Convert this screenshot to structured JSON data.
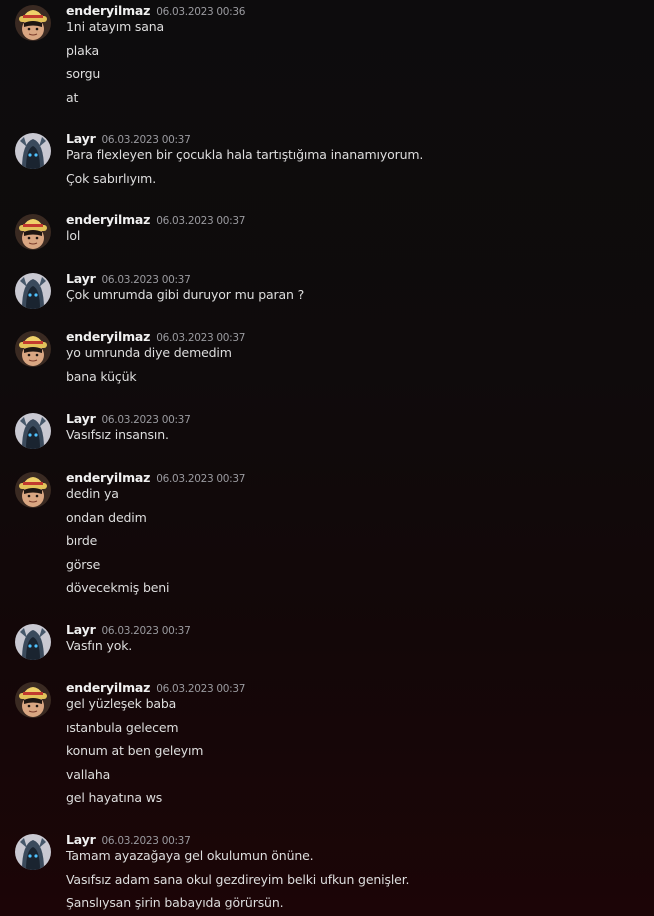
{
  "users": {
    "ender": {
      "name": "enderyilmaz",
      "avatar_icon": "straw-hat-avatar-icon"
    },
    "layr": {
      "name": "Layr",
      "avatar_icon": "hooded-figure-avatar-icon"
    }
  },
  "messages": [
    {
      "user": "enderyilmaz",
      "timestamp": "06.03.2023 00:36",
      "lines": [
        "1ni atayım sana",
        "plaka",
        "sorgu",
        "at"
      ]
    },
    {
      "user": "Layr",
      "timestamp": "06.03.2023 00:37",
      "lines": [
        "Para flexleyen bir çocukla hala tartıştığıma inanamıyorum.",
        "Çok sabırlıyım."
      ]
    },
    {
      "user": "enderyilmaz",
      "timestamp": "06.03.2023 00:37",
      "lines": [
        "lol"
      ]
    },
    {
      "user": "Layr",
      "timestamp": "06.03.2023 00:37",
      "lines": [
        "Çok umrumda gibi duruyor mu paran ?"
      ]
    },
    {
      "user": "enderyilmaz",
      "timestamp": "06.03.2023 00:37",
      "lines": [
        "yo umrunda diye demedim",
        "bana küçük"
      ]
    },
    {
      "user": "Layr",
      "timestamp": "06.03.2023 00:37",
      "lines": [
        "Vasıfsız insansın."
      ]
    },
    {
      "user": "enderyilmaz",
      "timestamp": "06.03.2023 00:37",
      "lines": [
        "dedin ya",
        "ondan dedim",
        "bırde",
        "görse",
        "dövecekmiş beni"
      ]
    },
    {
      "user": "Layr",
      "timestamp": "06.03.2023 00:37",
      "lines": [
        "Vasfın yok."
      ]
    },
    {
      "user": "enderyilmaz",
      "timestamp": "06.03.2023 00:37",
      "lines": [
        "gel yüzleşek baba",
        "ıstanbula gelecem",
        "konum at ben geleyım",
        "vallaha",
        "gel hayatına ws"
      ]
    },
    {
      "user": "Layr",
      "timestamp": "06.03.2023 00:37",
      "lines": [
        "Tamam ayazağaya gel okulumun önüne.",
        "Vasıfsız adam sana okul gezdireyim belki ufkun genişler.",
        "Şanslıysan şirin babayıda görürsün."
      ]
    }
  ]
}
